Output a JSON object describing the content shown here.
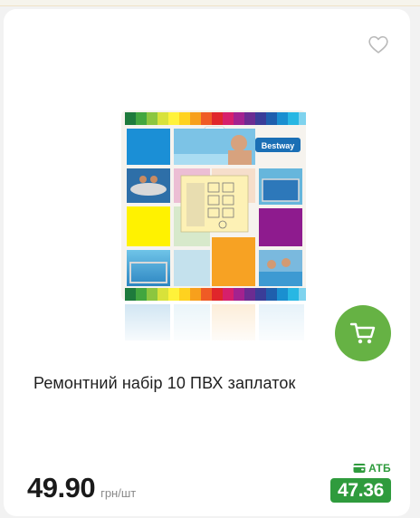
{
  "product": {
    "title": "Ремонтний набір 10 ПВХ заплаток",
    "brand_logo_text": "Bestway"
  },
  "pricing": {
    "price": "49.90",
    "unit": "грн/шт",
    "store_label": "АТБ",
    "store_price": "47.36"
  },
  "icons": {
    "favorite": "heart-outline-icon",
    "cart": "shopping-cart-icon",
    "store": "wallet-icon"
  },
  "colors": {
    "accent_green": "#66b244",
    "store_green": "#2f9b3d"
  }
}
